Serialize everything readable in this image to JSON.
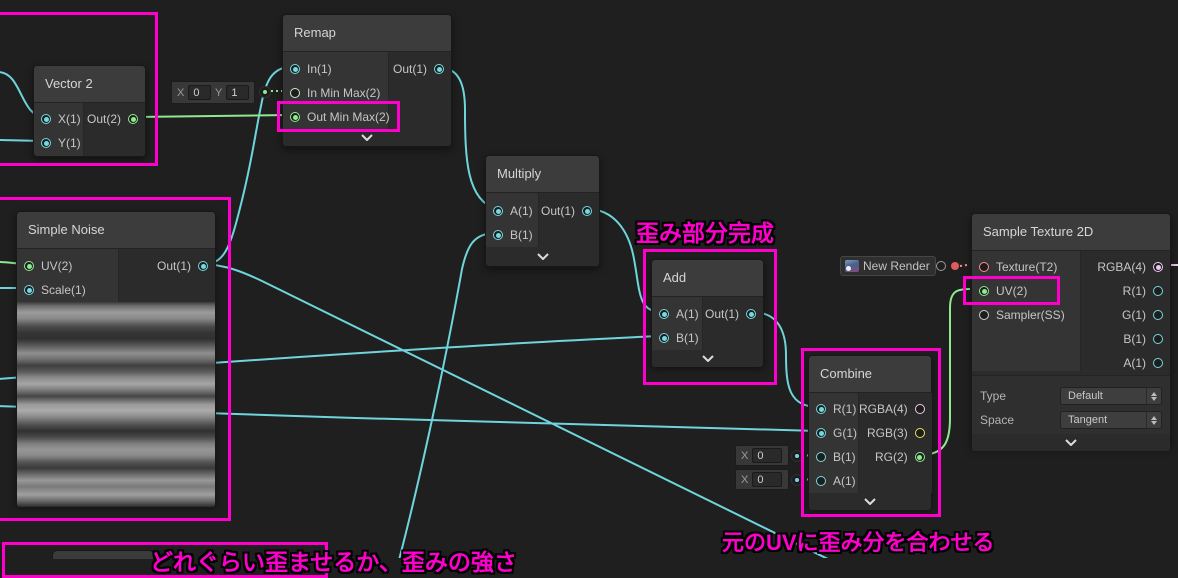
{
  "annotations": {
    "distortion_done": "歪み部分完成",
    "match_uv": "元のUVに歪み分を合わせる",
    "strength": "どれぐらい歪ませるか、歪みの強さ"
  },
  "colors": {
    "accent_magenta": "#ff00cc",
    "wire_cyan": "#6fd5dd",
    "wire_green": "#8fe98f",
    "port_yellow": "#e3e35e",
    "port_pink": "#edc9ed",
    "port_texture_red": "#ff8e8e"
  },
  "icons": {
    "collapse_chevron": "chevron-down",
    "texture_thumbnail": "image-thumbnail",
    "object_picker": "circle-ring",
    "dropdown_arrows": "up-down-triangles"
  },
  "nodes": {
    "vector2": {
      "title": "Vector 2",
      "inputs": [
        "X(1)",
        "Y(1)"
      ],
      "outputs": [
        "Out(2)"
      ]
    },
    "remap": {
      "title": "Remap",
      "inputs": [
        "In(1)",
        "In Min Max(2)",
        "Out Min Max(2)"
      ],
      "outputs": [
        "Out(1)"
      ]
    },
    "multiply": {
      "title": "Multiply",
      "inputs": [
        "A(1)",
        "B(1)"
      ],
      "outputs": [
        "Out(1)"
      ]
    },
    "simple_noise": {
      "title": "Simple Noise",
      "inputs": [
        "UV(2)",
        "Scale(1)"
      ],
      "outputs": [
        "Out(1)"
      ]
    },
    "add": {
      "title": "Add",
      "inputs": [
        "A(1)",
        "B(1)"
      ],
      "outputs": [
        "Out(1)"
      ]
    },
    "combine": {
      "title": "Combine",
      "inputs": [
        "R(1)",
        "G(1)",
        "B(1)",
        "A(1)"
      ],
      "outputs": [
        "RGBA(4)",
        "RGB(3)",
        "RG(2)"
      ]
    },
    "sample_texture_2d": {
      "title": "Sample Texture 2D",
      "inputs": [
        "Texture(T2)",
        "UV(2)",
        "Sampler(SS)"
      ],
      "outputs": [
        "RGBA(4)",
        "R(1)",
        "G(1)",
        "B(1)",
        "A(1)"
      ],
      "controls": [
        {
          "label": "Type",
          "value": "Default"
        },
        {
          "label": "Space",
          "value": "Tangent"
        }
      ]
    }
  },
  "widgets": {
    "remap_min_max": {
      "x_label": "X",
      "x_value": "0",
      "y_label": "Y",
      "y_value": "1"
    },
    "combine_b": {
      "x_label": "X",
      "x_value": "0"
    },
    "combine_a": {
      "x_label": "X",
      "x_value": "0"
    },
    "texture_field": {
      "value": "New Render"
    }
  }
}
